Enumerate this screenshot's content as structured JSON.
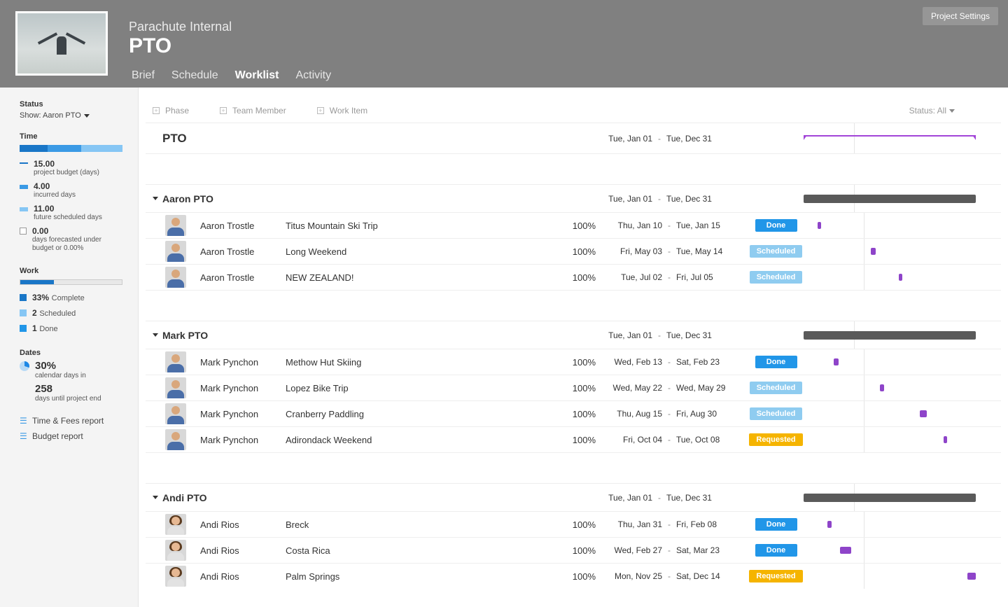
{
  "header": {
    "company": "Parachute Internal",
    "project": "PTO",
    "tabs": [
      "Brief",
      "Schedule",
      "Worklist",
      "Activity"
    ],
    "active_tab": "Worklist",
    "settings_btn": "Project Settings"
  },
  "sidebar": {
    "status_title": "Status",
    "show_label": "Show: Aaron PTO",
    "time_title": "Time",
    "time_stats": [
      {
        "value": "15.00",
        "label": "project budget (days)",
        "color": "#1976c7",
        "swatch": "dash"
      },
      {
        "value": "4.00",
        "label": "incurred days",
        "color": "#3b9ae5",
        "swatch": "solid"
      },
      {
        "value": "11.00",
        "label": "future scheduled days",
        "color": "#86c6f4",
        "swatch": "solid"
      },
      {
        "value": "0.00",
        "label": "days forecasted under budget or 0.00%",
        "color": "#ffffff",
        "swatch": "outline"
      }
    ],
    "work_title": "Work",
    "work_complete_pct": "33%",
    "work_stats": [
      {
        "value": "33%",
        "label": "Complete",
        "color": "#1976c7"
      },
      {
        "value": "2",
        "label": "Scheduled",
        "color": "#86c6f4"
      },
      {
        "value": "1",
        "label": "Done",
        "color": "#2196e8"
      }
    ],
    "dates_title": "Dates",
    "dates_pct": "30%",
    "dates_label1": "calendar days in",
    "dates_days": "258",
    "dates_label2": "days until project end",
    "reports": [
      "Time & Fees report",
      "Budget report"
    ]
  },
  "filters": {
    "items": [
      "Phase",
      "Team Member",
      "Work Item"
    ],
    "status_label": "Status: All"
  },
  "section_title": "PTO",
  "section_start": "Tue, Jan 01",
  "section_end": "Tue, Dec 31",
  "groups": [
    {
      "name": "Aaron PTO",
      "start": "Tue, Jan 01",
      "end": "Tue, Dec 31",
      "avatar": "m1",
      "items": [
        {
          "member": "Aaron Trostle",
          "task": "Titus Mountain Ski Trip",
          "pct": "100%",
          "start": "Thu, Jan 10",
          "end": "Tue, Jan 15",
          "status": "Done",
          "gleft": 6,
          "gwidth": 5
        },
        {
          "member": "Aaron Trostle",
          "task": "Long Weekend",
          "pct": "100%",
          "start": "Fri, May 03",
          "end": "Tue, May 14",
          "status": "Scheduled",
          "gleft": 82,
          "gwidth": 7
        },
        {
          "member": "Aaron Trostle",
          "task": "NEW ZEALAND!",
          "pct": "100%",
          "start": "Tue, Jul 02",
          "end": "Fri, Jul 05",
          "status": "Scheduled",
          "gleft": 122,
          "gwidth": 5
        }
      ]
    },
    {
      "name": "Mark PTO",
      "start": "Tue, Jan 01",
      "end": "Tue, Dec 31",
      "avatar": "m2",
      "items": [
        {
          "member": "Mark Pynchon",
          "task": "Methow Hut Skiing",
          "pct": "100%",
          "start": "Wed, Feb 13",
          "end": "Sat, Feb 23",
          "status": "Done",
          "gleft": 29,
          "gwidth": 7
        },
        {
          "member": "Mark Pynchon",
          "task": "Lopez Bike Trip",
          "pct": "100%",
          "start": "Wed, May 22",
          "end": "Wed, May 29",
          "status": "Scheduled",
          "gleft": 95,
          "gwidth": 6
        },
        {
          "member": "Mark Pynchon",
          "task": "Cranberry Paddling",
          "pct": "100%",
          "start": "Thu, Aug 15",
          "end": "Fri, Aug 30",
          "status": "Scheduled",
          "gleft": 152,
          "gwidth": 10
        },
        {
          "member": "Mark Pynchon",
          "task": "Adirondack Weekend",
          "pct": "100%",
          "start": "Fri, Oct 04",
          "end": "Tue, Oct 08",
          "status": "Requested",
          "gleft": 186,
          "gwidth": 5
        }
      ]
    },
    {
      "name": "Andi PTO",
      "start": "Tue, Jan 01",
      "end": "Tue, Dec 31",
      "avatar": "f1",
      "items": [
        {
          "member": "Andi Rios",
          "task": "Breck",
          "pct": "100%",
          "start": "Thu, Jan 31",
          "end": "Fri, Feb 08",
          "status": "Done",
          "gleft": 20,
          "gwidth": 6
        },
        {
          "member": "Andi Rios",
          "task": "Costa Rica",
          "pct": "100%",
          "start": "Wed, Feb 27",
          "end": "Sat, Mar 23",
          "status": "Done",
          "gleft": 38,
          "gwidth": 16
        },
        {
          "member": "Andi Rios",
          "task": "Palm Springs",
          "pct": "100%",
          "start": "Mon, Nov 25",
          "end": "Sat, Dec 14",
          "status": "Requested",
          "gleft": 220,
          "gwidth": 12
        }
      ]
    }
  ]
}
